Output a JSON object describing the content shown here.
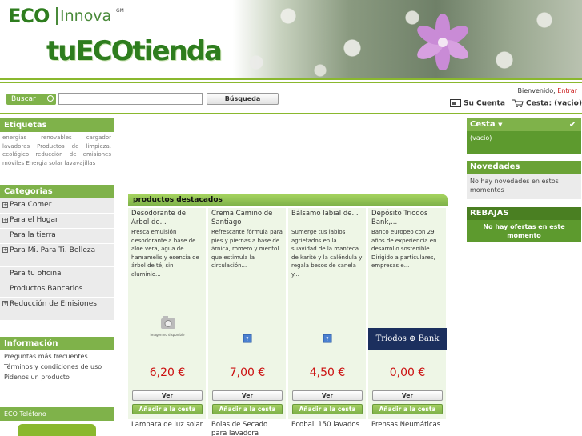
{
  "header": {
    "eco": "ECO",
    "innova": "Innova",
    "gm": "GM",
    "store_name": "tuECOtienda"
  },
  "topbar": {
    "search_label": "Buscar",
    "search_placeholder": "",
    "search_button": "Búsqueda",
    "welcome": "Bienvenido,",
    "login": "Entrar",
    "account": "Su Cuenta",
    "cart": "Cesta: (vacio)"
  },
  "tags": {
    "title": "Etiquetas",
    "cloud": "energias renovables cargador lavadoras Productos de limpieza. ecológico reducción de emisiones móviles Energia solar lavavajillas"
  },
  "categories": {
    "title": "Categorias",
    "items": [
      {
        "label": "Para Comer",
        "expandable": true
      },
      {
        "label": "Para el Hogar",
        "expandable": true
      },
      {
        "label": "Para la tierra",
        "expandable": false
      },
      {
        "label": "Para Mi. Para Ti. Belleza",
        "expandable": true
      },
      {
        "label": "Para tu oficina",
        "expandable": false
      },
      {
        "label": "Productos Bancarios",
        "expandable": false
      },
      {
        "label": "Reducción de Emisiones",
        "expandable": true
      }
    ]
  },
  "info": {
    "title": "Información",
    "links": [
      "Preguntas más frecuentes",
      "Términos y condiciones de uso",
      "Pidenos un producto"
    ]
  },
  "telefono": {
    "title": "ECO Teléfono"
  },
  "featured": {
    "title": "productos destacados",
    "products": [
      {
        "title": "Desodorante de Árbol de...",
        "desc": "Fresca emulsión desodorante a base de aloe vera, agua de hamamelis y esencia de árbol de té, sin aluminio...",
        "price": "6,20 €",
        "image": "no-image",
        "image_caption": "Imagen no disponible"
      },
      {
        "title": "Crema Camino de Santiago",
        "desc": "Refrescante fórmula para pies y piernas a base de árnica, romero y mentol que estimula la circulación...",
        "price": "7,00 €",
        "image": "broken"
      },
      {
        "title": "Bálsamo labial de...",
        "desc": "Sumerge tus labios agrietados en la suavidad de la manteca de karité y la caléndula y regala besos de canela y...",
        "price": "4,50 €",
        "image": "broken"
      },
      {
        "title": "Depósito Triodos Bank,...",
        "desc": "Banco europeo con 29 años de experiencia en desarrollo sostenible. Dirigido a particulares, empresas e...",
        "price": "0,00 €",
        "image": "triodos",
        "logo_text": "Triodos ⊕ Bank"
      }
    ],
    "view_label": "Ver",
    "add_label": "Añadir a la cesta",
    "next_row": [
      "Lampara de luz solar",
      "Bolas de Secado para lavadora",
      "Ecoball 150 lavados",
      "Prensas Neumáticas"
    ]
  },
  "right": {
    "cart_title": "Cesta",
    "cart_body": "(vacio)",
    "new_title": "Novedades",
    "new_body": "No hay novedades en estos momentos",
    "sales_title": "REBAJAS",
    "sales_body": "No hay ofertas en este momento"
  },
  "colors": {
    "brand_green": "#7fb24a",
    "dark_green": "#5d9a2e",
    "price_red": "#cc1111"
  }
}
